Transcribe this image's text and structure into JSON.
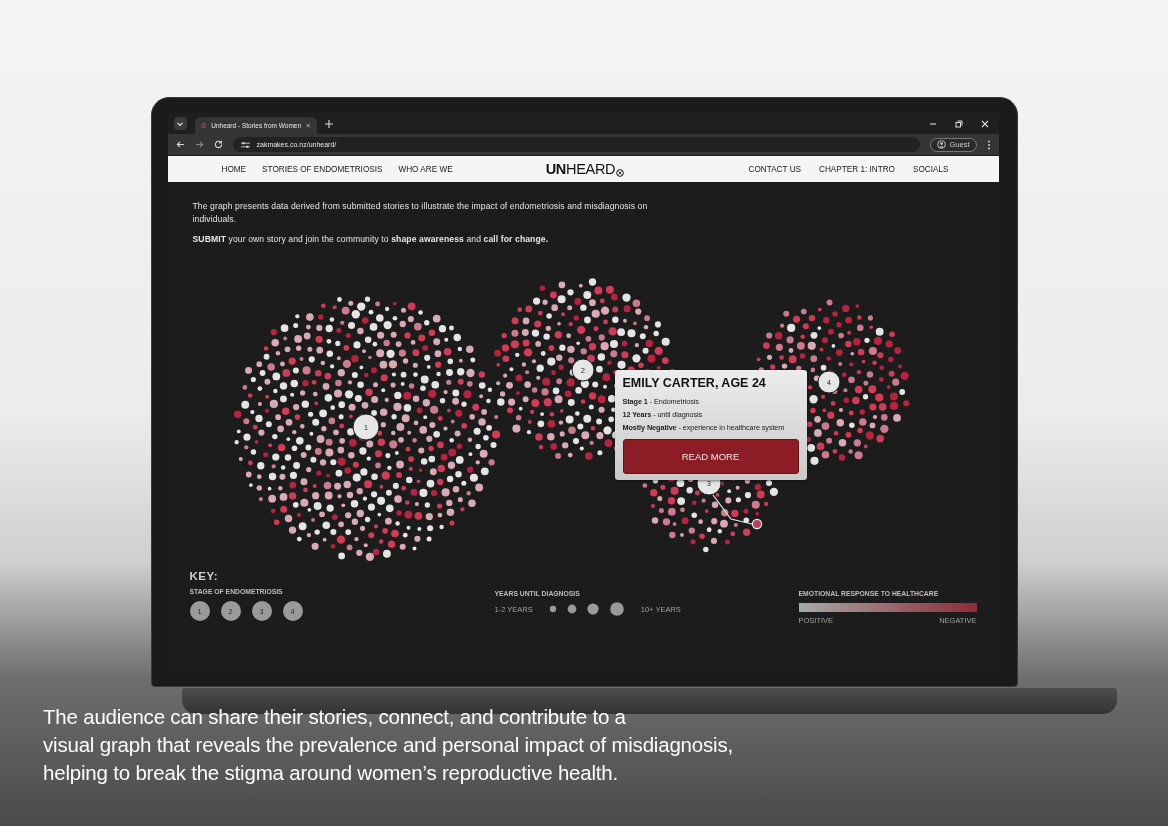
{
  "browser": {
    "tab_title": "Unheard - Stories from Women",
    "url": "zakmakes.co.nz/unheard/",
    "profile": "Guest"
  },
  "nav": {
    "left": [
      "HOME",
      "STORIES OF ENDOMETRIOSIS",
      "WHO ARE WE"
    ],
    "logo": "**UN**HEARD",
    "right": [
      "CONTACT US",
      "CHAPTER 1: INTRO",
      "SOCIALS"
    ]
  },
  "intro": [
    "The graph presents data derived from submitted stories to illustrate the impact of endometriosis and misdiagnosis on individuals.",
    "**SUBMIT** your own story and join the community to **shape awareness** and **call for change.**"
  ],
  "clusters": [
    {
      "label": "1"
    },
    {
      "label": "2"
    },
    {
      "label": "3"
    },
    {
      "label": "4"
    }
  ],
  "tooltip": {
    "title": "EMILY CARTER, AGE 24",
    "lines": [
      "**Stage 1** - Endometriosis",
      "**12 Years** - until diagnosis",
      "**Mostly Negative** - experience in healthcare system"
    ],
    "button": "READ MORE"
  },
  "key": {
    "title": "KEY:",
    "stage": {
      "title": "STAGE OF ENDOMETRIOSIS",
      "items": [
        "1",
        "2",
        "3",
        "4"
      ]
    },
    "years": {
      "title": "YEARS UNTIL DIAGNOSIS",
      "min_label": "1-2 YEARS",
      "max_label": "10+ YEARS"
    },
    "emotion": {
      "title": "EMOTIONAL RESPONSE TO HEALTHCARE",
      "low_label": "POSITIVE",
      "high_label": "NEGATIVE"
    }
  },
  "caption": [
    "The audience can share their stories, connect, and contribute to a",
    "visual graph that reveals the prevalence and personal impact of misdiagnosis,",
    "helping to break the stigma around women’s reproductive health."
  ]
}
